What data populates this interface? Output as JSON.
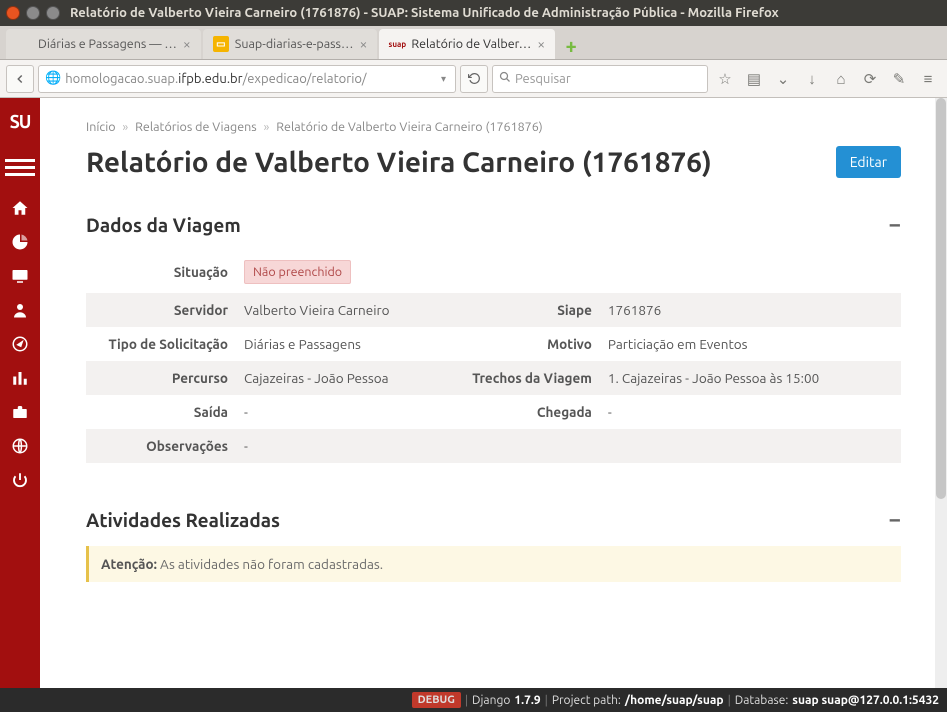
{
  "window": {
    "title": "Relatório de Valberto Vieira Carneiro (1761876) - SUAP: Sistema Unificado de Administração Pública - Mozilla Firefox"
  },
  "tabs": [
    {
      "label": "Diárias e Passagens — …",
      "active": false,
      "favicon": ""
    },
    {
      "label": "Suap-diarias-e-pass…",
      "active": false,
      "favicon": "slides"
    },
    {
      "label": "Relatório de Valber…",
      "active": true,
      "favicon": "suap"
    }
  ],
  "nav": {
    "url_prefix": "homologacao.suap.",
    "url_domain": "ifpb.edu.br",
    "url_path": "/expedicao/relatorio/",
    "search_placeholder": "Pesquisar"
  },
  "sidebar": {
    "brand": "SU"
  },
  "breadcrumb": {
    "items": [
      "Início",
      "Relatórios de Viagens",
      "Relatório de Valberto Vieira Carneiro (1761876)"
    ]
  },
  "page_title": "Relatório de Valberto Vieira Carneiro (1761876)",
  "edit_button": "Editar",
  "section1": {
    "title": "Dados da Viagem",
    "rows": {
      "situacao_label": "Situação",
      "situacao_value": "Não preenchido",
      "servidor_label": "Servidor",
      "servidor_value": "Valberto Vieira Carneiro",
      "siape_label": "Siape",
      "siape_value": "1761876",
      "tipo_label": "Tipo de Solicitação",
      "tipo_value": "Diárias e Passagens",
      "motivo_label": "Motivo",
      "motivo_value": "Particiação em Eventos",
      "percurso_label": "Percurso",
      "percurso_value": "Cajazeiras - João Pessoa",
      "trechos_label": "Trechos da Viagem",
      "trechos_value": "1. Cajazeiras - João Pessoa às 15:00",
      "saida_label": "Saída",
      "saida_value": "-",
      "chegada_label": "Chegada",
      "chegada_value": "-",
      "obs_label": "Observações",
      "obs_value": "-"
    }
  },
  "section2": {
    "title": "Atividades Realizadas",
    "warning_label": "Atenção:",
    "warning_text": " As atividades não foram cadastradas."
  },
  "debug": {
    "tag": "DEBUG",
    "django_label": "Django",
    "django_ver": "1.7.9",
    "path_label": "Project path:",
    "path_value": "/home/suap/suap",
    "db_label": "Database:",
    "db_value": "suap suap@127.0.0.1:5432"
  }
}
